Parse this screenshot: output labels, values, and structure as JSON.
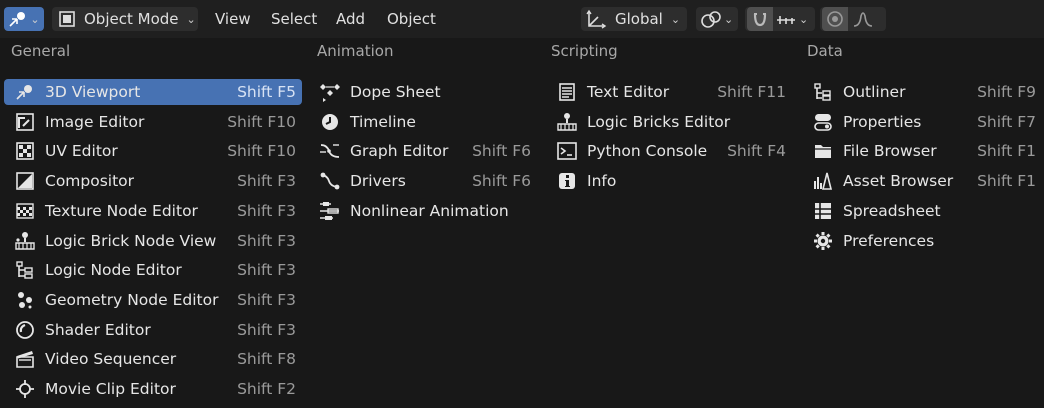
{
  "header": {
    "mode_label": "Object Mode",
    "menus": [
      "View",
      "Select",
      "Add",
      "Object"
    ],
    "orientation_label": "Global"
  },
  "columns": [
    {
      "title": "General",
      "items": [
        {
          "label": "3D Viewport",
          "shortcut": "Shift F5",
          "icon": "viewport-3d-icon",
          "active": true
        },
        {
          "label": "Image Editor",
          "shortcut": "Shift F10",
          "icon": "image-editor-icon"
        },
        {
          "label": "UV Editor",
          "shortcut": "Shift F10",
          "icon": "uv-editor-icon"
        },
        {
          "label": "Compositor",
          "shortcut": "Shift F3",
          "icon": "compositor-icon"
        },
        {
          "label": "Texture Node Editor",
          "shortcut": "Shift F3",
          "icon": "texture-node-icon"
        },
        {
          "label": "Logic Brick Node View",
          "shortcut": "Shift F3",
          "icon": "logic-brick-node-icon"
        },
        {
          "label": "Logic Node Editor",
          "shortcut": "Shift F3",
          "icon": "logic-node-icon"
        },
        {
          "label": "Geometry Node Editor",
          "shortcut": "Shift F3",
          "icon": "geometry-node-icon"
        },
        {
          "label": "Shader Editor",
          "shortcut": "Shift F3",
          "icon": "shader-editor-icon"
        },
        {
          "label": "Video Sequencer",
          "shortcut": "Shift F8",
          "icon": "video-sequencer-icon"
        },
        {
          "label": "Movie Clip Editor",
          "shortcut": "Shift F2",
          "icon": "movie-clip-icon"
        }
      ]
    },
    {
      "title": "Animation",
      "items": [
        {
          "label": "Dope Sheet",
          "shortcut": "",
          "icon": "dope-sheet-icon"
        },
        {
          "label": "Timeline",
          "shortcut": "",
          "icon": "timeline-icon"
        },
        {
          "label": "Graph Editor",
          "shortcut": "Shift F6",
          "icon": "graph-editor-icon"
        },
        {
          "label": "Drivers",
          "shortcut": "Shift F6",
          "icon": "drivers-icon"
        },
        {
          "label": "Nonlinear Animation",
          "shortcut": "",
          "icon": "nla-icon"
        }
      ]
    },
    {
      "title": "Scripting",
      "items": [
        {
          "label": "Text Editor",
          "shortcut": "Shift F11",
          "icon": "text-editor-icon"
        },
        {
          "label": "Logic Bricks Editor",
          "shortcut": "",
          "icon": "logic-bricks-icon"
        },
        {
          "label": "Python Console",
          "shortcut": "Shift F4",
          "icon": "python-console-icon"
        },
        {
          "label": "Info",
          "shortcut": "",
          "icon": "info-icon"
        }
      ]
    },
    {
      "title": "Data",
      "items": [
        {
          "label": "Outliner",
          "shortcut": "Shift F9",
          "icon": "outliner-icon"
        },
        {
          "label": "Properties",
          "shortcut": "Shift F7",
          "icon": "properties-icon"
        },
        {
          "label": "File Browser",
          "shortcut": "Shift F1",
          "icon": "file-browser-icon"
        },
        {
          "label": "Asset Browser",
          "shortcut": "Shift F1",
          "icon": "asset-browser-icon"
        },
        {
          "label": "Spreadsheet",
          "shortcut": "",
          "icon": "spreadsheet-icon"
        },
        {
          "label": "Preferences",
          "shortcut": "",
          "icon": "preferences-icon"
        }
      ]
    }
  ],
  "colors": {
    "accent": "#4772b3",
    "background": "#181818",
    "header": "#1f1f1f"
  }
}
